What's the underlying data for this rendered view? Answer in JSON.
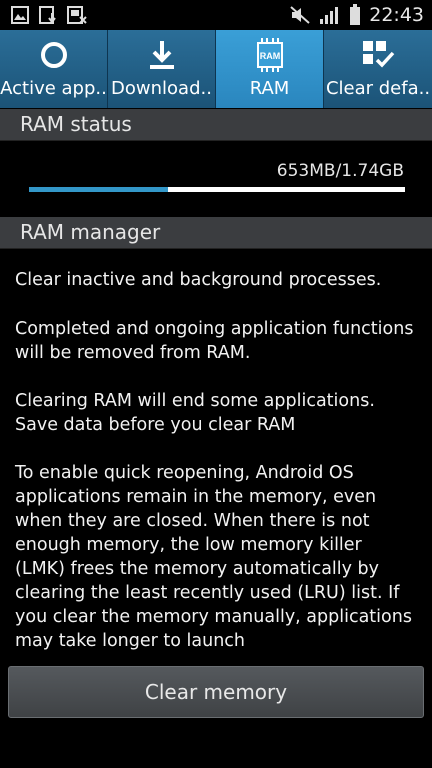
{
  "status_bar": {
    "time": "22:43",
    "icons": [
      "gallery-icon",
      "download-icon",
      "screenshot-icon",
      "mute-icon",
      "signal-icon",
      "battery-icon"
    ]
  },
  "tabs": [
    {
      "label": "Active app..",
      "icon": "ring-icon",
      "active": false
    },
    {
      "label": "Download..",
      "icon": "download-icon",
      "active": false
    },
    {
      "label": "RAM",
      "icon": "ram-icon",
      "icon_text": "RAM",
      "active": true
    },
    {
      "label": "Clear defa..",
      "icon": "clear-defaults-icon",
      "active": false
    }
  ],
  "ram_status": {
    "header": "RAM status",
    "usage_text": "653MB/1.74GB",
    "used_fraction": 0.37
  },
  "ram_manager": {
    "header": "RAM manager",
    "paragraphs": [
      "Clear inactive and background processes.",
      "Completed and ongoing application functions will be removed from RAM.",
      "Clearing RAM will end some applications. Save data before you clear RAM",
      "To enable quick reopening, Android OS applications remain in the memory, even when they are closed. When there is not enough memory, the low memory killer (LMK) frees the memory automatically by clearing the least recently used (LRU) list. If you clear the memory manually, applications may take longer to launch"
    ]
  },
  "clear_button": {
    "label": "Clear memory"
  },
  "colors": {
    "tab_active": "#3a9fd7",
    "tab_inactive": "#245f85",
    "progress": "#3397c8",
    "header_bg": "#3b3d40"
  }
}
